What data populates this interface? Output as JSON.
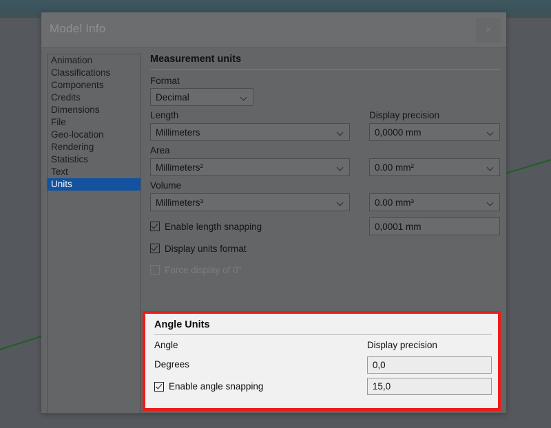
{
  "window": {
    "title": "Model Info",
    "close_label": "×"
  },
  "sidebar": {
    "items": [
      {
        "label": "Animation",
        "selected": false
      },
      {
        "label": "Classifications",
        "selected": false
      },
      {
        "label": "Components",
        "selected": false
      },
      {
        "label": "Credits",
        "selected": false
      },
      {
        "label": "Dimensions",
        "selected": false
      },
      {
        "label": "File",
        "selected": false
      },
      {
        "label": "Geo-location",
        "selected": false
      },
      {
        "label": "Rendering",
        "selected": false
      },
      {
        "label": "Statistics",
        "selected": false
      },
      {
        "label": "Text",
        "selected": false
      },
      {
        "label": "Units",
        "selected": true
      }
    ]
  },
  "measurement": {
    "title": "Measurement units",
    "format_label": "Format",
    "format_value": "Decimal",
    "display_precision_label": "Display precision",
    "length_label": "Length",
    "length_value": "Millimeters",
    "length_precision": "0,0000 mm",
    "area_label": "Area",
    "area_value": "Millimeters²",
    "area_precision": "0.00 mm²",
    "volume_label": "Volume",
    "volume_value": "Millimeters³",
    "volume_precision": "0.00 mm³",
    "enable_length_snapping_label": "Enable length snapping",
    "enable_length_snapping_checked": true,
    "length_snapping_value": "0,0001 mm",
    "display_units_format_label": "Display units format",
    "display_units_format_checked": true,
    "force_display_zero_label": "Force display of 0\"",
    "force_display_zero_checked": false,
    "force_display_zero_enabled": false
  },
  "angle_units": {
    "title": "Angle Units",
    "angle_label": "Angle",
    "display_precision_label": "Display precision",
    "degrees_label": "Degrees",
    "degrees_precision": "0,0",
    "enable_angle_snapping_label": "Enable angle snapping",
    "enable_angle_snapping_checked": true,
    "angle_snapping_value": "15,0",
    "highlight_color": "#ee1b17"
  }
}
